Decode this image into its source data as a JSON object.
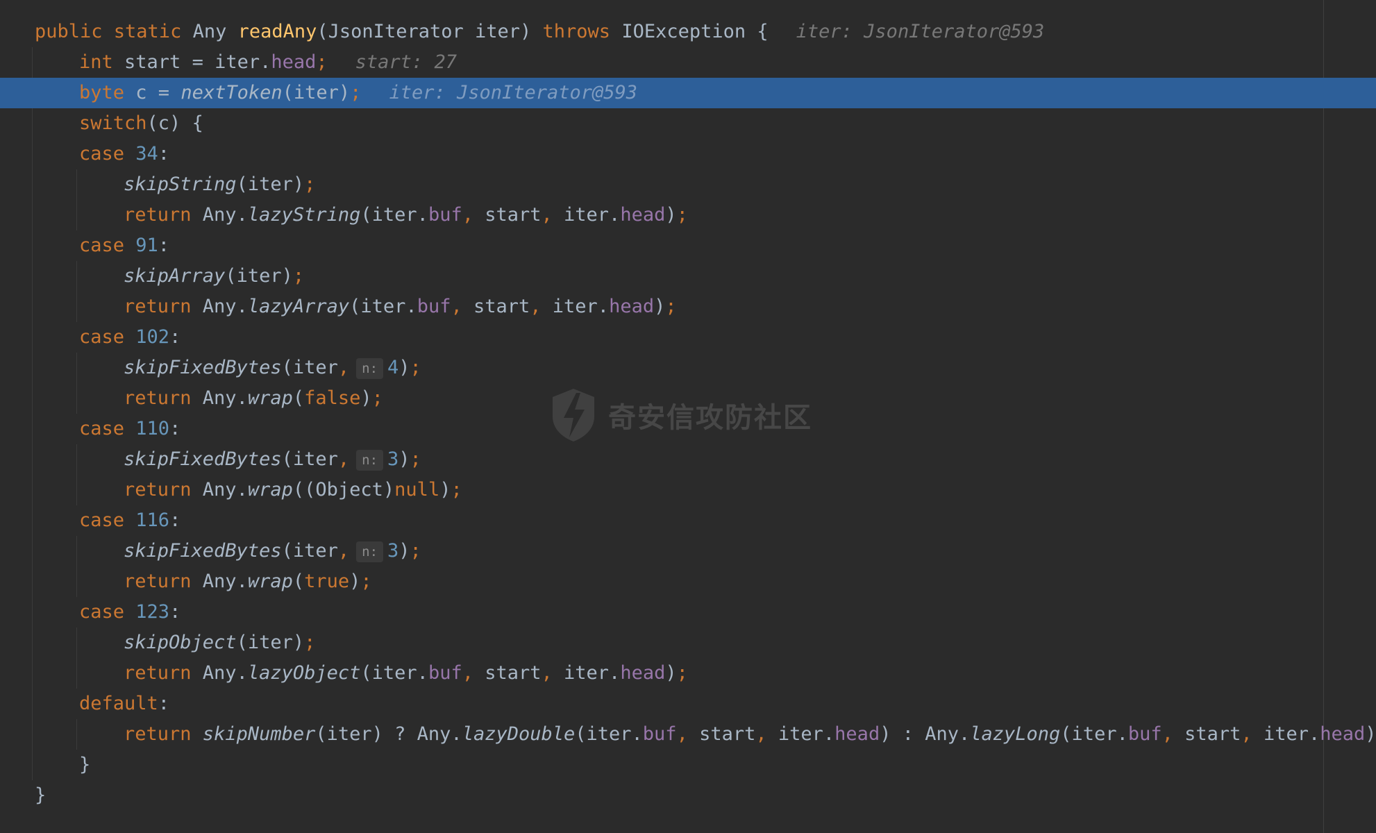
{
  "editor": {
    "language": "java",
    "watermark_text": "奇安信攻防社区",
    "lines": [
      {
        "indent": 0,
        "highlighted": false,
        "tokens": [
          {
            "t": "public static ",
            "c": "kw"
          },
          {
            "t": "Any "
          },
          {
            "t": "readAny",
            "c": "fn"
          },
          {
            "t": "(JsonIterator iter) "
          },
          {
            "t": "throws ",
            "c": "kw"
          },
          {
            "t": "IOException {"
          },
          {
            "t": "iter: JsonIterator@593",
            "c": "hint"
          }
        ]
      },
      {
        "indent": 1,
        "highlighted": false,
        "tokens": [
          {
            "t": "int ",
            "c": "kw"
          },
          {
            "t": "start = iter."
          },
          {
            "t": "head",
            "c": "fld"
          },
          {
            "t": ";",
            "c": "kw"
          },
          {
            "t": "start: 27",
            "c": "hint"
          }
        ]
      },
      {
        "indent": 1,
        "highlighted": true,
        "tokens": [
          {
            "t": "byte ",
            "c": "kw"
          },
          {
            "t": "c = "
          },
          {
            "t": "nextToken",
            "c": "it"
          },
          {
            "t": "(iter)"
          },
          {
            "t": ";",
            "c": "kw"
          },
          {
            "t": "iter: JsonIterator@593",
            "c": "hint"
          }
        ]
      },
      {
        "indent": 1,
        "highlighted": false,
        "tokens": [
          {
            "t": "switch",
            "c": "kw"
          },
          {
            "t": "(c) {"
          }
        ]
      },
      {
        "indent": 1,
        "highlighted": false,
        "tokens": [
          {
            "t": "case ",
            "c": "kw"
          },
          {
            "t": "34",
            "c": "num"
          },
          {
            "t": ":"
          }
        ]
      },
      {
        "indent": 2,
        "highlighted": false,
        "tokens": [
          {
            "t": "skipString",
            "c": "it"
          },
          {
            "t": "(iter)"
          },
          {
            "t": ";",
            "c": "kw"
          }
        ]
      },
      {
        "indent": 2,
        "highlighted": false,
        "tokens": [
          {
            "t": "return ",
            "c": "kw"
          },
          {
            "t": "Any."
          },
          {
            "t": "lazyString",
            "c": "it"
          },
          {
            "t": "(iter."
          },
          {
            "t": "buf",
            "c": "fld"
          },
          {
            "t": ", ",
            "c": "kw"
          },
          {
            "t": "start"
          },
          {
            "t": ", ",
            "c": "kw"
          },
          {
            "t": "iter."
          },
          {
            "t": "head",
            "c": "fld"
          },
          {
            "t": ")"
          },
          {
            "t": ";",
            "c": "kw"
          }
        ]
      },
      {
        "indent": 1,
        "highlighted": false,
        "tokens": [
          {
            "t": "case ",
            "c": "kw"
          },
          {
            "t": "91",
            "c": "num"
          },
          {
            "t": ":"
          }
        ]
      },
      {
        "indent": 2,
        "highlighted": false,
        "tokens": [
          {
            "t": "skipArray",
            "c": "it"
          },
          {
            "t": "(iter)"
          },
          {
            "t": ";",
            "c": "kw"
          }
        ]
      },
      {
        "indent": 2,
        "highlighted": false,
        "tokens": [
          {
            "t": "return ",
            "c": "kw"
          },
          {
            "t": "Any."
          },
          {
            "t": "lazyArray",
            "c": "it"
          },
          {
            "t": "(iter."
          },
          {
            "t": "buf",
            "c": "fld"
          },
          {
            "t": ", ",
            "c": "kw"
          },
          {
            "t": "start"
          },
          {
            "t": ", ",
            "c": "kw"
          },
          {
            "t": "iter."
          },
          {
            "t": "head",
            "c": "fld"
          },
          {
            "t": ")"
          },
          {
            "t": ";",
            "c": "kw"
          }
        ]
      },
      {
        "indent": 1,
        "highlighted": false,
        "tokens": [
          {
            "t": "case ",
            "c": "kw"
          },
          {
            "t": "102",
            "c": "num"
          },
          {
            "t": ":"
          }
        ]
      },
      {
        "indent": 2,
        "highlighted": false,
        "tokens": [
          {
            "t": "skipFixedBytes",
            "c": "it"
          },
          {
            "t": "(iter"
          },
          {
            "t": ",",
            "c": "kw"
          },
          {
            "t": "n:",
            "c": "phint"
          },
          {
            "t": "4",
            "c": "num"
          },
          {
            "t": ")"
          },
          {
            "t": ";",
            "c": "kw"
          }
        ]
      },
      {
        "indent": 2,
        "highlighted": false,
        "tokens": [
          {
            "t": "return ",
            "c": "kw"
          },
          {
            "t": "Any."
          },
          {
            "t": "wrap",
            "c": "it"
          },
          {
            "t": "("
          },
          {
            "t": "false",
            "c": "kw"
          },
          {
            "t": ")"
          },
          {
            "t": ";",
            "c": "kw"
          }
        ]
      },
      {
        "indent": 1,
        "highlighted": false,
        "tokens": [
          {
            "t": "case ",
            "c": "kw"
          },
          {
            "t": "110",
            "c": "num"
          },
          {
            "t": ":"
          }
        ]
      },
      {
        "indent": 2,
        "highlighted": false,
        "tokens": [
          {
            "t": "skipFixedBytes",
            "c": "it"
          },
          {
            "t": "(iter"
          },
          {
            "t": ",",
            "c": "kw"
          },
          {
            "t": "n:",
            "c": "phint"
          },
          {
            "t": "3",
            "c": "num"
          },
          {
            "t": ")"
          },
          {
            "t": ";",
            "c": "kw"
          }
        ]
      },
      {
        "indent": 2,
        "highlighted": false,
        "tokens": [
          {
            "t": "return ",
            "c": "kw"
          },
          {
            "t": "Any."
          },
          {
            "t": "wrap",
            "c": "it"
          },
          {
            "t": "((Object)"
          },
          {
            "t": "null",
            "c": "kw"
          },
          {
            "t": ")"
          },
          {
            "t": ";",
            "c": "kw"
          }
        ]
      },
      {
        "indent": 1,
        "highlighted": false,
        "tokens": [
          {
            "t": "case ",
            "c": "kw"
          },
          {
            "t": "116",
            "c": "num"
          },
          {
            "t": ":"
          }
        ]
      },
      {
        "indent": 2,
        "highlighted": false,
        "tokens": [
          {
            "t": "skipFixedBytes",
            "c": "it"
          },
          {
            "t": "(iter"
          },
          {
            "t": ",",
            "c": "kw"
          },
          {
            "t": "n:",
            "c": "phint"
          },
          {
            "t": "3",
            "c": "num"
          },
          {
            "t": ")"
          },
          {
            "t": ";",
            "c": "kw"
          }
        ]
      },
      {
        "indent": 2,
        "highlighted": false,
        "tokens": [
          {
            "t": "return ",
            "c": "kw"
          },
          {
            "t": "Any."
          },
          {
            "t": "wrap",
            "c": "it"
          },
          {
            "t": "("
          },
          {
            "t": "true",
            "c": "kw"
          },
          {
            "t": ")"
          },
          {
            "t": ";",
            "c": "kw"
          }
        ]
      },
      {
        "indent": 1,
        "highlighted": false,
        "tokens": [
          {
            "t": "case ",
            "c": "kw"
          },
          {
            "t": "123",
            "c": "num"
          },
          {
            "t": ":"
          }
        ]
      },
      {
        "indent": 2,
        "highlighted": false,
        "tokens": [
          {
            "t": "skipObject",
            "c": "it"
          },
          {
            "t": "(iter)"
          },
          {
            "t": ";",
            "c": "kw"
          }
        ]
      },
      {
        "indent": 2,
        "highlighted": false,
        "tokens": [
          {
            "t": "return ",
            "c": "kw"
          },
          {
            "t": "Any."
          },
          {
            "t": "lazyObject",
            "c": "it"
          },
          {
            "t": "(iter."
          },
          {
            "t": "buf",
            "c": "fld"
          },
          {
            "t": ", ",
            "c": "kw"
          },
          {
            "t": "start"
          },
          {
            "t": ", ",
            "c": "kw"
          },
          {
            "t": "iter."
          },
          {
            "t": "head",
            "c": "fld"
          },
          {
            "t": ")"
          },
          {
            "t": ";",
            "c": "kw"
          }
        ]
      },
      {
        "indent": 1,
        "highlighted": false,
        "tokens": [
          {
            "t": "default",
            "c": "kw"
          },
          {
            "t": ":"
          }
        ]
      },
      {
        "indent": 2,
        "highlighted": false,
        "tokens": [
          {
            "t": "return ",
            "c": "kw"
          },
          {
            "t": "skipNumber",
            "c": "it"
          },
          {
            "t": "(iter) ? Any."
          },
          {
            "t": "lazyDouble",
            "c": "it"
          },
          {
            "t": "(iter."
          },
          {
            "t": "buf",
            "c": "fld"
          },
          {
            "t": ", ",
            "c": "kw"
          },
          {
            "t": "start"
          },
          {
            "t": ", ",
            "c": "kw"
          },
          {
            "t": "iter."
          },
          {
            "t": "head",
            "c": "fld"
          },
          {
            "t": ") : Any."
          },
          {
            "t": "lazyLong",
            "c": "it"
          },
          {
            "t": "(iter."
          },
          {
            "t": "buf",
            "c": "fld"
          },
          {
            "t": ", ",
            "c": "kw"
          },
          {
            "t": "start"
          },
          {
            "t": ", ",
            "c": "kw"
          },
          {
            "t": "iter."
          },
          {
            "t": "head",
            "c": "fld"
          },
          {
            "t": ")"
          },
          {
            "t": ";",
            "c": "kw"
          }
        ]
      },
      {
        "indent": 1,
        "highlighted": false,
        "tokens": [
          {
            "t": "}"
          }
        ]
      },
      {
        "indent": 0,
        "highlighted": false,
        "tokens": [
          {
            "t": "}"
          }
        ]
      }
    ]
  }
}
